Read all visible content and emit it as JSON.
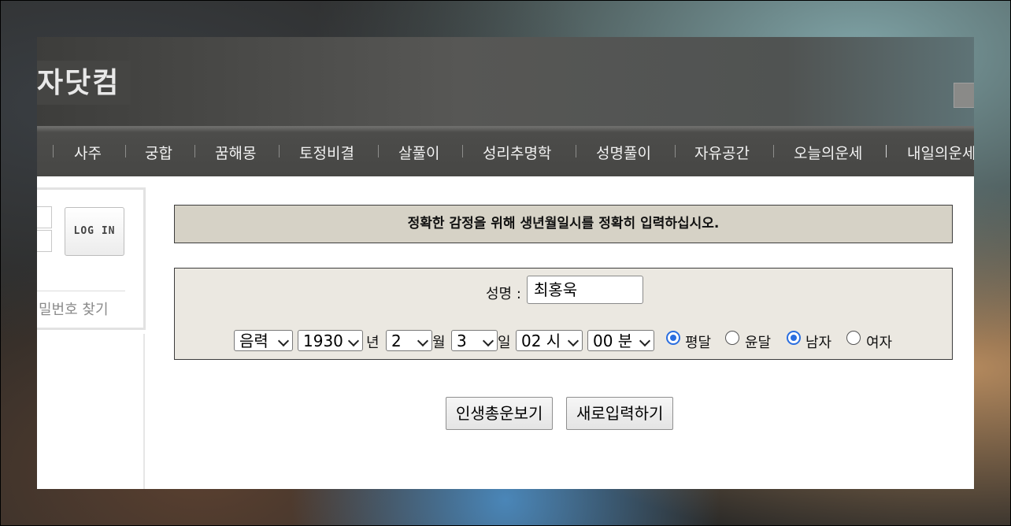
{
  "header": {
    "logo_text": "자닷컴"
  },
  "nav": {
    "items": [
      {
        "label": "사주"
      },
      {
        "label": "궁합"
      },
      {
        "label": "꿈해몽"
      },
      {
        "label": "토정비결"
      },
      {
        "label": "살풀이"
      },
      {
        "label": "성리추명학"
      },
      {
        "label": "성명풀이"
      },
      {
        "label": "자유공간"
      },
      {
        "label": "오늘의운세"
      },
      {
        "label": "내일의운세"
      }
    ]
  },
  "login": {
    "button_label": "LOG IN",
    "find_password_label": "밀번호 찾기"
  },
  "form": {
    "notice": "정확한 감정을 위해 생년월일시를 정확히 입력하십시오.",
    "name_label": "성명 :",
    "name_value": "최홍욱",
    "calendar_type": "음력",
    "year": "1930",
    "year_unit": "년",
    "month": "2",
    "month_unit": "월",
    "day": "3",
    "day_unit": "일",
    "hour": "02 시",
    "minute": "00 분",
    "radios": {
      "normal_month": {
        "label": "평달",
        "checked": true
      },
      "leap_month": {
        "label": "윤달",
        "checked": false
      },
      "male": {
        "label": "남자",
        "checked": true
      },
      "female": {
        "label": "여자",
        "checked": false
      }
    },
    "submit_label": "인생총운보기",
    "reset_label": "새로입력하기"
  },
  "colors": {
    "header_bg": "#4c4c4a",
    "notice_bg": "#d6d2c6",
    "form_bg": "#ebe8e1",
    "radio_accent": "#2a6ee0"
  }
}
